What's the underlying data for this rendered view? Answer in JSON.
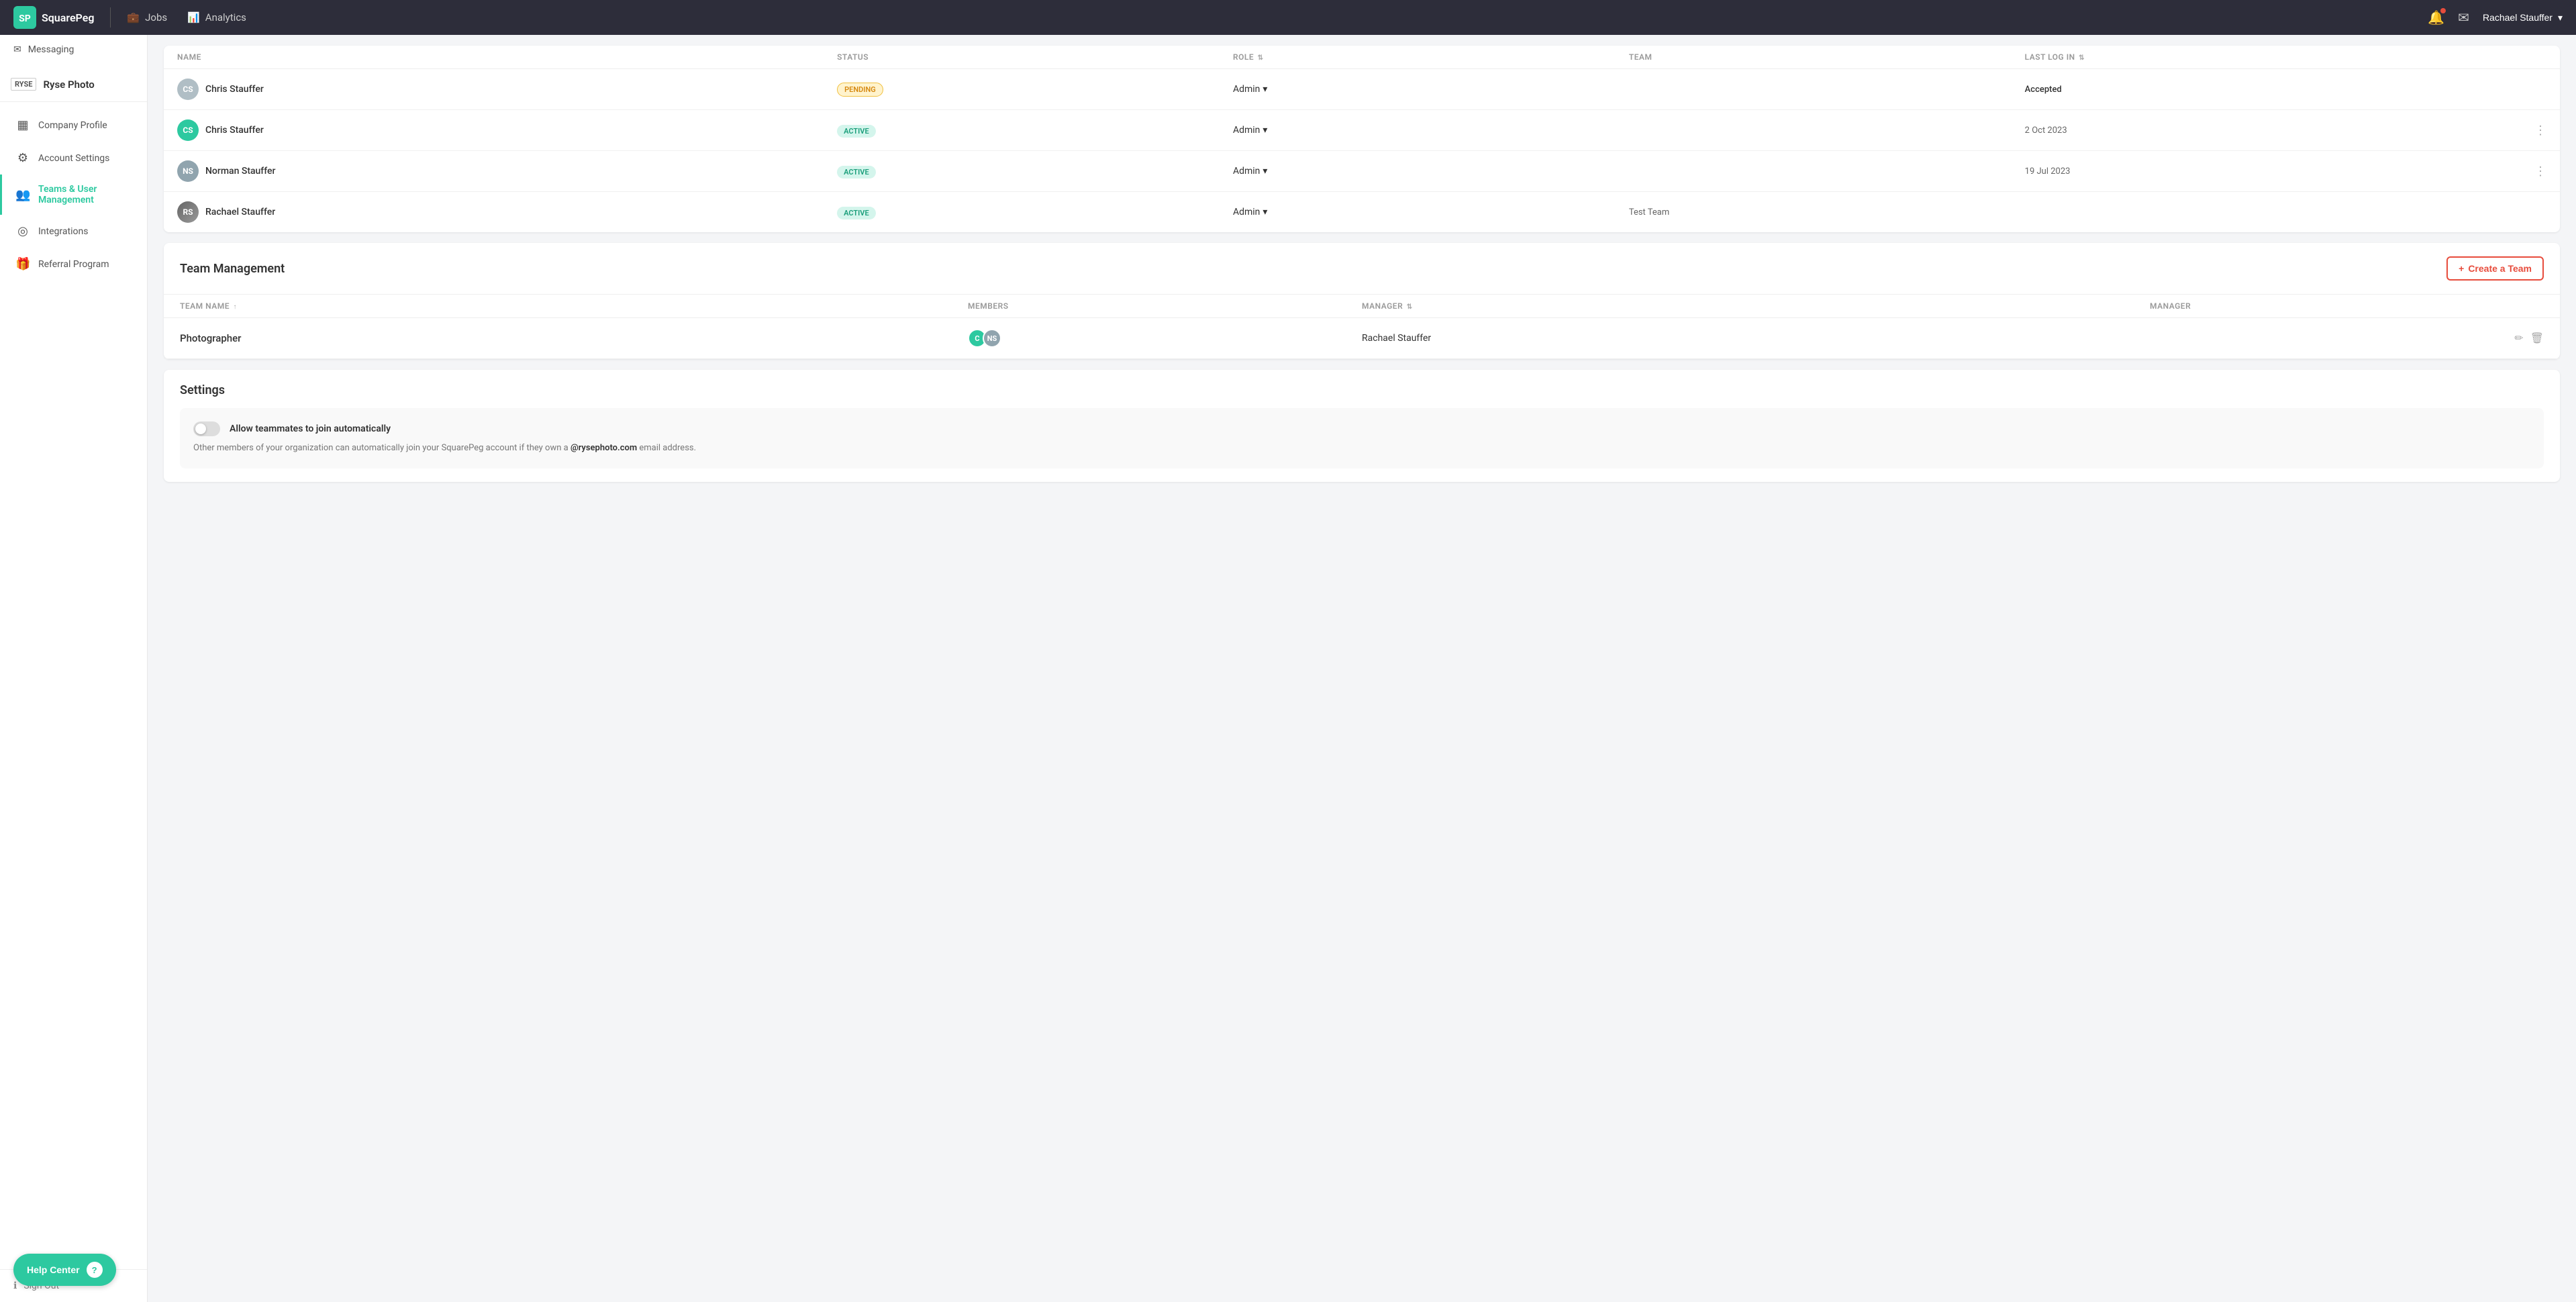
{
  "topnav": {
    "logo_text": "SquarePeg",
    "nav_items": [
      {
        "id": "jobs",
        "label": "Jobs",
        "icon": "💼"
      },
      {
        "id": "analytics",
        "label": "Analytics",
        "icon": "📊"
      }
    ],
    "user_name": "Rachael Stauffer"
  },
  "sidebar": {
    "company": {
      "logo_abbr": "RYSE",
      "name": "Ryse Photo"
    },
    "top_item": {
      "label": "Messaging",
      "icon": "✉"
    },
    "items": [
      {
        "id": "company-profile",
        "label": "Company Profile",
        "icon": "▦",
        "active": false
      },
      {
        "id": "account-settings",
        "label": "Account Settings",
        "icon": "⚙",
        "active": false
      },
      {
        "id": "teams-user-management",
        "label": "Teams & User Management",
        "icon": "👥",
        "active": true
      },
      {
        "id": "integrations",
        "label": "Integrations",
        "icon": "◎",
        "active": false
      },
      {
        "id": "referral-program",
        "label": "Referral Program",
        "icon": "🎁",
        "active": false
      }
    ],
    "sign_out_label": "Sign Out",
    "help_btn_label": "Help Center"
  },
  "users_table": {
    "columns": [
      {
        "id": "name",
        "label": "NAME"
      },
      {
        "id": "status",
        "label": "STATUS"
      },
      {
        "id": "role",
        "label": "ROLE"
      },
      {
        "id": "team",
        "label": "TEAM"
      },
      {
        "id": "last_login",
        "label": "LAST LOG IN"
      },
      {
        "id": "actions",
        "label": ""
      }
    ],
    "rows": [
      {
        "id": "row-1",
        "initials": "CS",
        "avatar_color": "#b0bec5",
        "name": "Chris Stauffer",
        "status": "PENDING",
        "status_type": "pending",
        "role": "Admin",
        "team": "",
        "last_login": "Accepted",
        "last_login_type": "accepted",
        "has_menu": false
      },
      {
        "id": "row-2",
        "initials": "CS",
        "avatar_color": "#2dc9a0",
        "name": "Chris Stauffer",
        "status": "ACTIVE",
        "status_type": "active",
        "role": "Admin",
        "team": "",
        "last_login": "2 Oct 2023",
        "last_login_type": "date",
        "has_menu": true
      },
      {
        "id": "row-3",
        "initials": "NS",
        "avatar_color": "#90a4ae",
        "name": "Norman Stauffer",
        "status": "ACTIVE",
        "status_type": "active",
        "role": "Admin",
        "team": "",
        "last_login": "19 Jul 2023",
        "last_login_type": "date",
        "has_menu": true
      },
      {
        "id": "row-4",
        "initials": "RS",
        "avatar_color": "#555",
        "name": "Rachael Stauffer",
        "status": "ACTIVE",
        "status_type": "active",
        "role": "Admin",
        "team": "Test Team",
        "last_login": "",
        "last_login_type": "date",
        "has_menu": false,
        "has_photo": true
      }
    ]
  },
  "team_management": {
    "title": "Team Management",
    "create_btn_label": "+ Create a Team",
    "columns": [
      {
        "id": "team-name",
        "label": "TEAM NAME"
      },
      {
        "id": "members",
        "label": "MEMBERS"
      },
      {
        "id": "manager",
        "label": "MANAGER"
      },
      {
        "id": "manager2",
        "label": "MANAGER"
      }
    ],
    "teams": [
      {
        "id": "photographer",
        "name": "Photographer",
        "members": [
          {
            "initials": "C",
            "color": "#2dc9a0"
          },
          {
            "initials": "NS",
            "color": "#90a4ae"
          }
        ],
        "manager": "Rachael Stauffer"
      }
    ]
  },
  "settings": {
    "title": "Settings",
    "toggle_card": {
      "label": "Allow teammates to join automatically",
      "toggle_on": false,
      "description_before": "Other members of your organization can automatically join your SquarePeg account if they own a ",
      "highlight_email": "@rysephoto.com",
      "description_after": " email address."
    }
  }
}
